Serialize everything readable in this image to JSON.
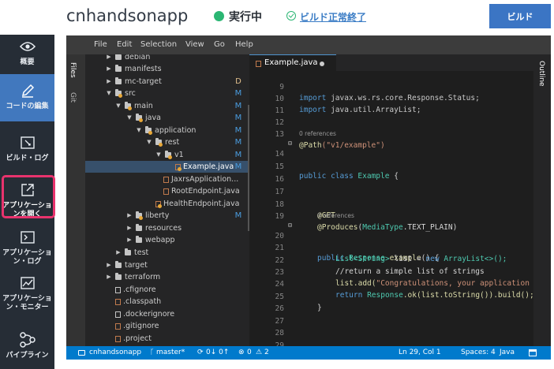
{
  "header": {
    "app_name": "cnhandsonapp",
    "status": "実行中",
    "build_status": "ビルド正常終了",
    "build_button": "ビルド",
    "status_color": "#2bb673"
  },
  "nav": {
    "items": [
      {
        "label": "概要",
        "icon": "eye-icon"
      },
      {
        "label": "コードの編集",
        "icon": "pencil-icon"
      },
      {
        "label": "ビルド・ログ",
        "icon": "build-log-icon"
      },
      {
        "label": "アプリケーションを開く",
        "icon": "external-link-icon"
      },
      {
        "label": "アプリケーション・ログ",
        "icon": "terminal-icon"
      },
      {
        "label": "アプリケーション・モニター",
        "icon": "monitor-chart-icon"
      },
      {
        "label": "パイプライン",
        "icon": "pipeline-icon"
      }
    ],
    "active_index": 1,
    "highlight_color": "#e8336d"
  },
  "editor": {
    "menu": [
      "File",
      "Edit",
      "Selection",
      "View",
      "Go",
      "Help"
    ],
    "side_tabs": {
      "files": "Files",
      "git": "Git",
      "outline": "Outline"
    },
    "tab": {
      "filename": "Example.java"
    },
    "tree": [
      {
        "name": "debian",
        "kind": "folder",
        "open": false,
        "git": ""
      },
      {
        "name": "manifests",
        "kind": "folder",
        "open": false,
        "git": ""
      },
      {
        "name": "mc-target",
        "kind": "folder",
        "open": false,
        "git": "D"
      },
      {
        "name": "src",
        "kind": "folder",
        "open": true,
        "git": "M"
      },
      {
        "name": "main",
        "kind": "folder",
        "open": true,
        "git": "M"
      },
      {
        "name": "java",
        "kind": "folder",
        "open": true,
        "git": "M"
      },
      {
        "name": "application",
        "kind": "folder",
        "open": true,
        "git": "M"
      },
      {
        "name": "rest",
        "kind": "folder",
        "open": true,
        "git": "M"
      },
      {
        "name": "v1",
        "kind": "folder",
        "open": true,
        "git": "M"
      },
      {
        "name": "Example.java",
        "kind": "file",
        "git": "M"
      },
      {
        "name": "JaxrsApplication...",
        "kind": "file",
        "git": ""
      },
      {
        "name": "RootEndpoint.java",
        "kind": "file",
        "git": ""
      },
      {
        "name": "HealthEndpoint.java",
        "kind": "file",
        "git": ""
      },
      {
        "name": "liberty",
        "kind": "folder",
        "open": false,
        "git": "M"
      },
      {
        "name": "resources",
        "kind": "folder",
        "open": false,
        "git": ""
      },
      {
        "name": "webapp",
        "kind": "folder",
        "open": false,
        "git": ""
      },
      {
        "name": "test",
        "kind": "folder",
        "open": false,
        "git": ""
      },
      {
        "name": "target",
        "kind": "folder",
        "open": false,
        "git": ""
      },
      {
        "name": "terraform",
        "kind": "folder",
        "open": false,
        "git": ""
      },
      {
        "name": ".cfignore",
        "kind": "file",
        "git": ""
      },
      {
        "name": ".classpath",
        "kind": "file",
        "git": ""
      },
      {
        "name": ".dockerignore",
        "kind": "file",
        "git": ""
      },
      {
        "name": ".gitignore",
        "kind": "file",
        "git": ""
      },
      {
        "name": ".project",
        "kind": "file",
        "git": ""
      }
    ],
    "code": {
      "ln9": "9",
      "ln10": "10",
      "ln11": "11",
      "ln12": "12",
      "ln13": "13",
      "ln14": "14",
      "ln15": "15",
      "ln16": "16",
      "ln17": "17",
      "ln18": "18",
      "ln19": "19",
      "ln20": "20",
      "ln21": "21",
      "ln22": "22",
      "ln23": "23",
      "ln24": "24",
      "ln25": "25",
      "ln26": "26",
      "ln27": "27",
      "ln28": "28",
      "ln29": "29",
      "import_kw": "import",
      "import9": "javax.ws.rs.core.Response.Status;",
      "import10": "java.util.ArrayList;",
      "path_annotation": "@Path",
      "path_value": "(\"v1/example\")",
      "refs": "0 references",
      "class_public": "public",
      "class_kw": "class",
      "class_name": "Example",
      "class_brace": "{",
      "get_annotation": "@GET",
      "produces_annotation": "@Produces",
      "produces_open": "(",
      "media_type": "MediaType",
      "produces_rest": ".TEXT_PLAIN)",
      "m_public": "public",
      "m_type": "Response",
      "m_name": "example",
      "m_rest": "() {",
      "list_type": "List<String>",
      "list_decl": " list = ",
      "new_kw": "new",
      "list_new": "ArrayList<>();",
      "comment": "//return a simple list of strings",
      "add_call": "list.add(",
      "add_str": "\"Congratulations, your application",
      "return_kw": "return",
      "return_type": "Response",
      "return_rest": ".ok(list.toString()).build();",
      "close_method": "}",
      "close_class": "}"
    },
    "status_bar": {
      "project": "cnhandsonapp",
      "branch": "master*",
      "sync": "0↓ 0↑",
      "problems": "0",
      "warnings": "2",
      "position": "Ln 29, Col 1",
      "spaces": "Spaces: 4",
      "language": "Java"
    }
  }
}
